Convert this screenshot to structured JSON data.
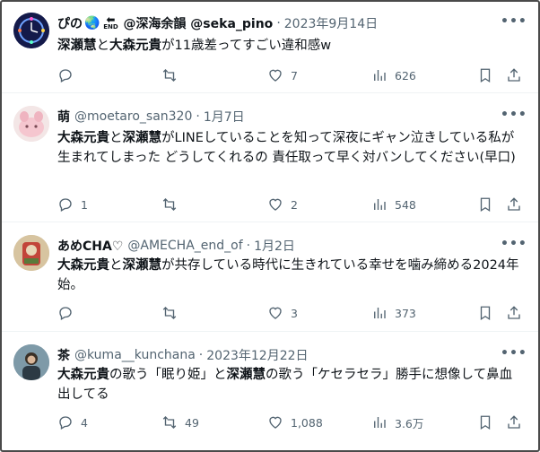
{
  "tweets": [
    {
      "name": "ぴの",
      "emoji": "🌏",
      "end_label": "END",
      "handle": "@深海余韻 @seka_pino",
      "date": "2023年9月14日",
      "parts": [
        {
          "b": "深瀬慧"
        },
        {
          "t": "と"
        },
        {
          "b": "大森元貴"
        },
        {
          "t": "が11歳差ってすごい違和感w"
        }
      ],
      "replies": "",
      "retweets": "",
      "likes": "7",
      "views": "626"
    },
    {
      "name": "萌",
      "handle": "@moetaro_san320",
      "date": "1月7日",
      "parts": [
        {
          "b": "大森元貴"
        },
        {
          "t": "と"
        },
        {
          "b": "深瀬慧"
        },
        {
          "t": "がLINEしていることを知って深夜にギャン泣きしている私が生まれてしまった どうしてくれるの 責任取って早く対バンしてください(早口)"
        }
      ],
      "replies": "1",
      "retweets": "",
      "likes": "2",
      "views": "548"
    },
    {
      "name": "あめCHA♡",
      "handle": "@AMECHA_end_of",
      "date": "1月2日",
      "parts": [
        {
          "b": "大森元貴"
        },
        {
          "t": "と"
        },
        {
          "b": "深瀬慧"
        },
        {
          "t": "が共存している時代に生きれている幸せを噛み締める2024年始。"
        }
      ],
      "replies": "",
      "retweets": "",
      "likes": "3",
      "views": "373"
    },
    {
      "name": "茶",
      "handle": "@kuma__kunchana",
      "date": "2023年12月22日",
      "parts": [
        {
          "b": "大森元貴"
        },
        {
          "t": "の歌う「眠り姫」と"
        },
        {
          "b": "深瀬慧"
        },
        {
          "t": "の歌う「ケセラセラ」勝手に想像して鼻血出してる"
        }
      ],
      "replies": "4",
      "retweets": "49",
      "likes": "1,088",
      "views": "3.6万"
    }
  ],
  "icons": {
    "reply": "reply-icon",
    "retweet": "retweet-icon",
    "like": "heart-icon",
    "views": "views-bar-chart-icon",
    "bookmark": "bookmark-icon",
    "share": "share-icon",
    "more": "more-dots-icon"
  },
  "colors": {
    "text": "#0f1419",
    "secondary": "#536471",
    "divider": "#eff3f4"
  }
}
